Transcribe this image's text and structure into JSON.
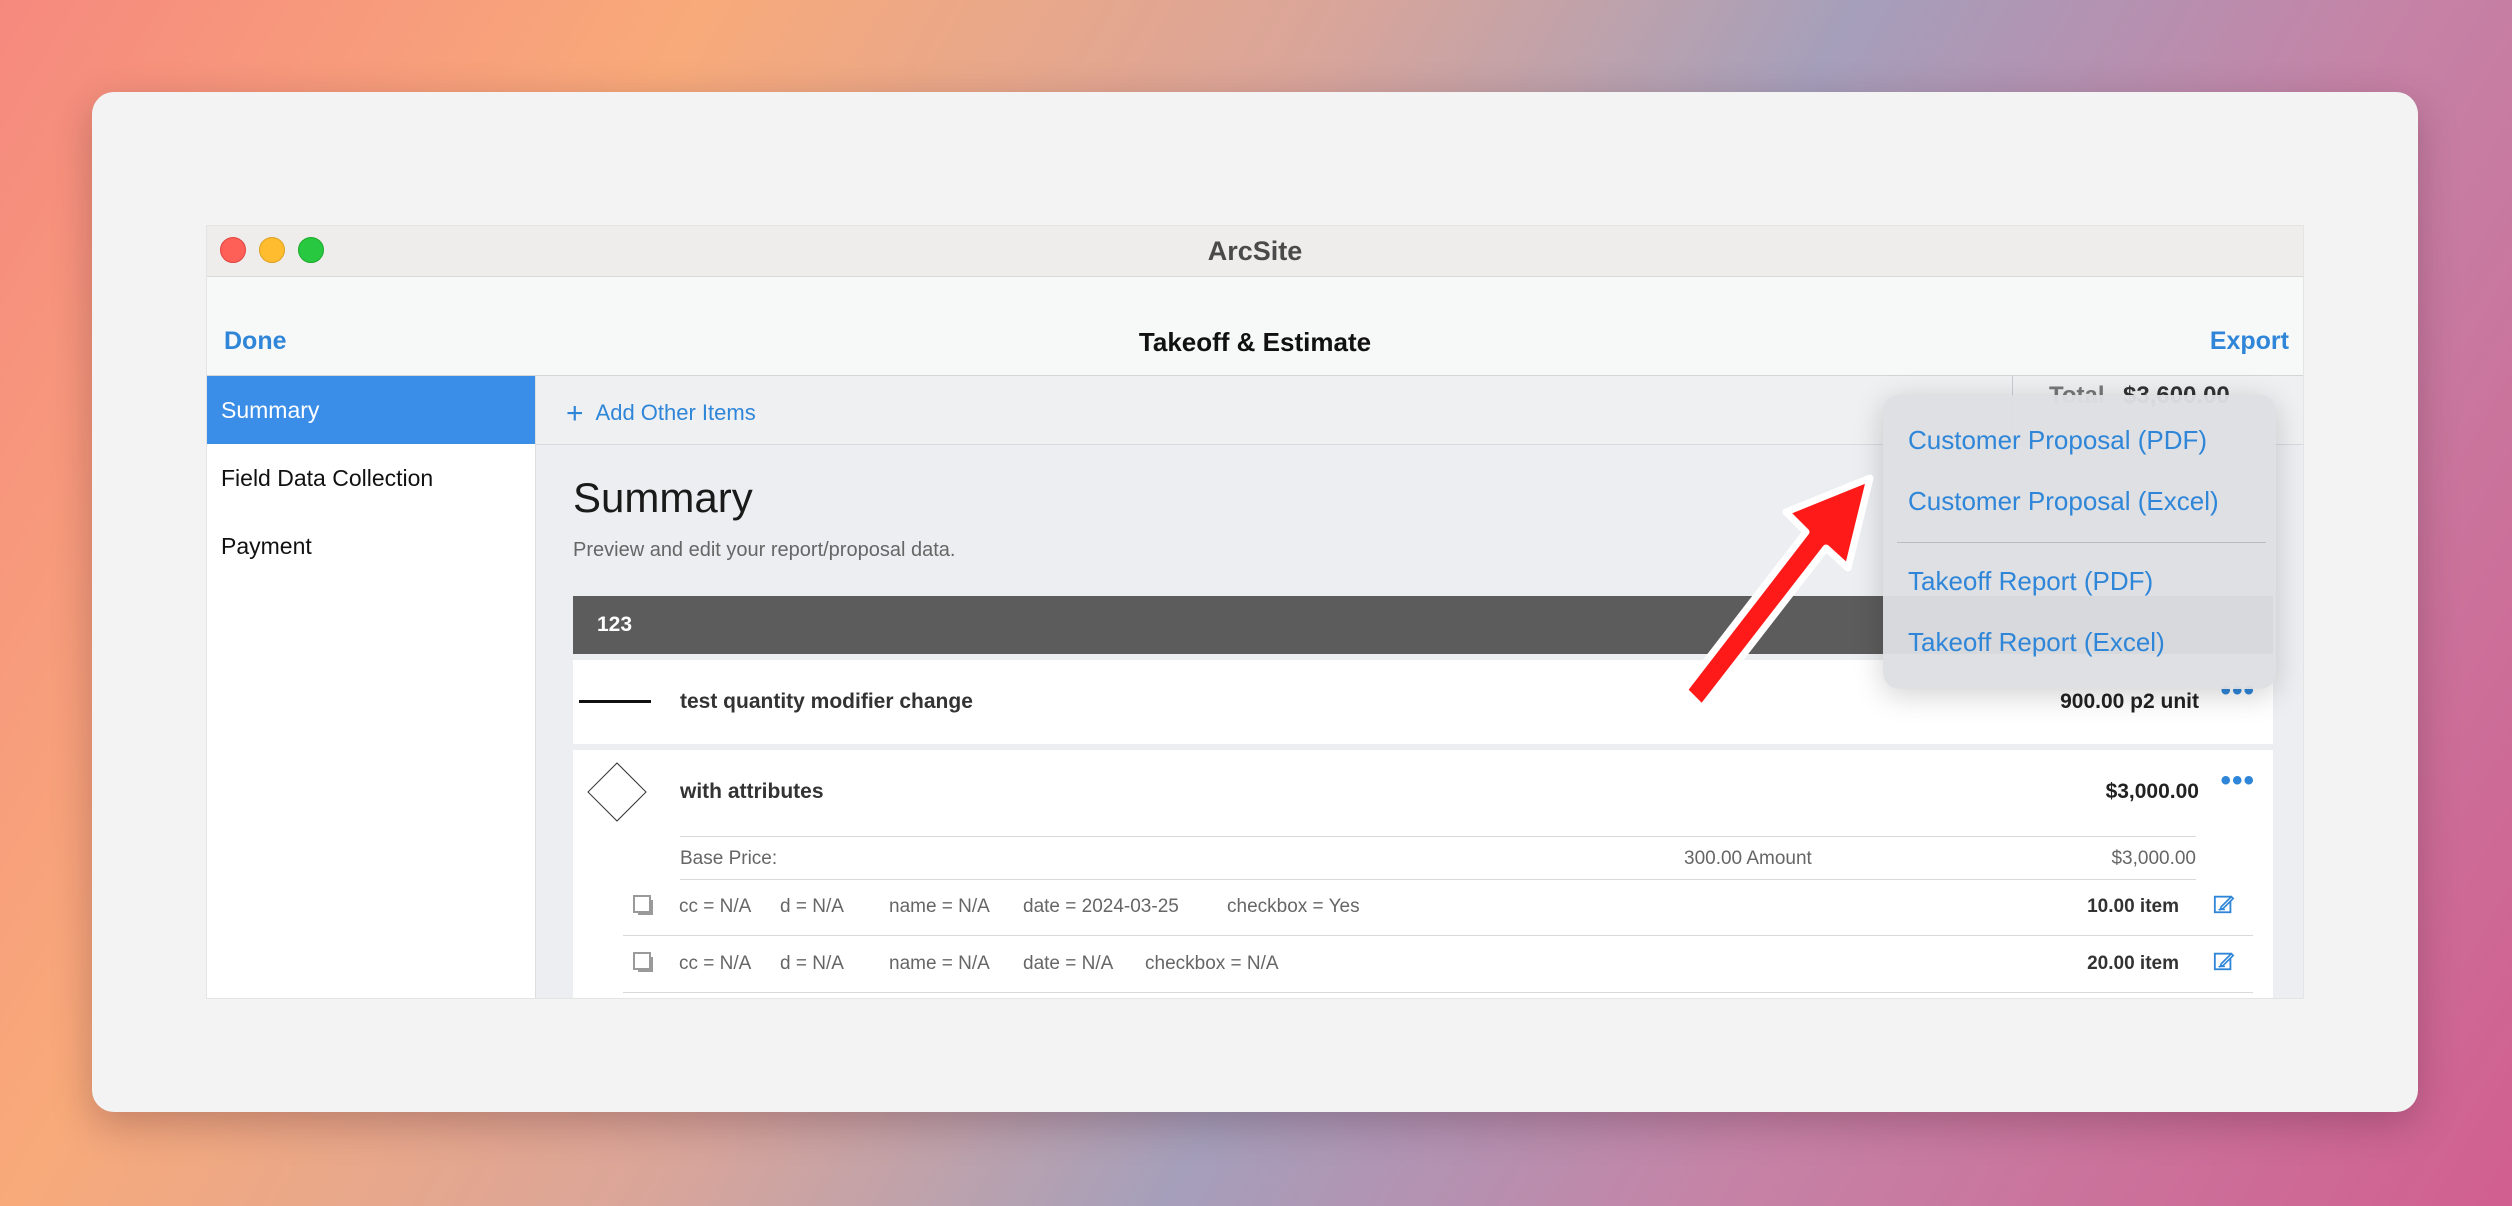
{
  "window": {
    "title": "ArcSite"
  },
  "navbar": {
    "left_button": "Done",
    "title": "Takeoff & Estimate",
    "right_button": "Export"
  },
  "sidebar": {
    "items": [
      {
        "label": "Summary",
        "active": true
      },
      {
        "label": "Field Data Collection",
        "active": false
      },
      {
        "label": "Payment",
        "active": false
      }
    ]
  },
  "toolbar": {
    "add_label": "Add Other Items",
    "total_label": "Total",
    "total_value": "$3,600.00"
  },
  "summary": {
    "title": "Summary",
    "subtitle": "Preview and edit your report/proposal data.",
    "group": "123",
    "items": [
      {
        "icon": "line-icon",
        "name": "test quantity modifier change",
        "amount": "900.00 p2 unit"
      },
      {
        "icon": "diamond-icon",
        "name": "with attributes",
        "amount": "$3,000.00",
        "base_price": {
          "label": "Base Price:",
          "qty": "300.00 Amount",
          "amount": "$3,000.00"
        },
        "attribute_rows": [
          {
            "cc": "cc = N/A",
            "d": "d = N/A",
            "name": "name = N/A",
            "date": "date = 2024-03-25",
            "checkbox": "checkbox = Yes",
            "qty": "10.00 item"
          },
          {
            "cc": "cc = N/A",
            "d": "d = N/A",
            "name": "name = N/A",
            "date": "date = N/A",
            "checkbox": "checkbox = N/A",
            "qty": "20.00 item"
          }
        ]
      }
    ]
  },
  "export_menu": {
    "items": [
      "Customer Proposal (PDF)",
      "Customer Proposal (Excel)",
      "Takeoff Report (PDF)",
      "Takeoff Report (Excel)"
    ]
  },
  "colors": {
    "accent": "#2f86d8",
    "sidebar_active": "#3a8ee8",
    "group_bar": "#5c5c5c",
    "arrow": "#ff1a1a"
  }
}
